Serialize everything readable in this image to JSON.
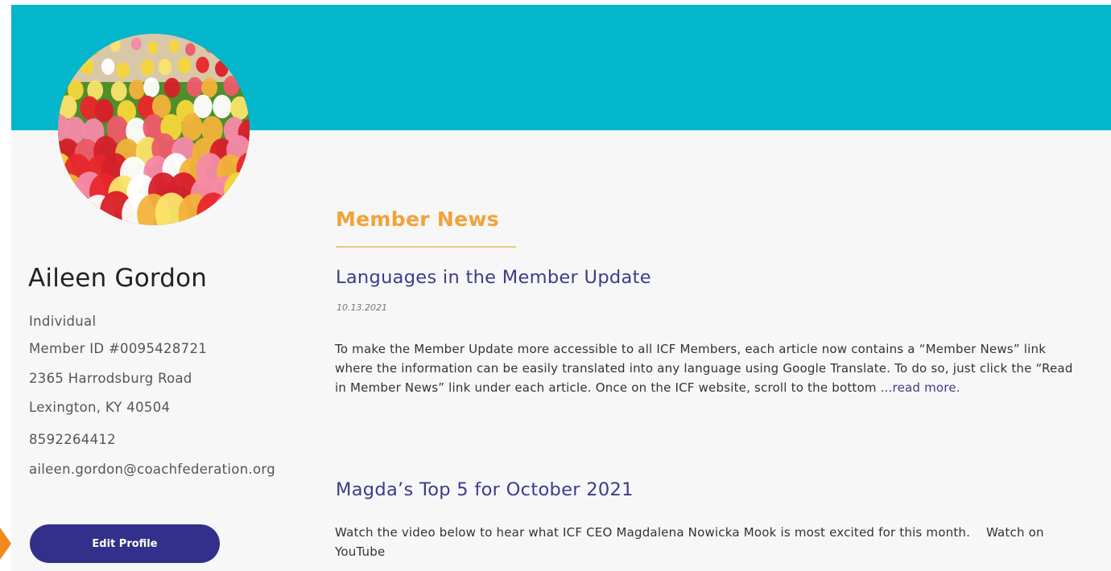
{
  "profile": {
    "name": "Aileen Gordon",
    "membership_type": "Individual",
    "member_id": "Member ID #0095428721",
    "address_line1": "2365 Harrodsburg Road",
    "address_line2": "Lexington, KY 40504",
    "phone": "8592264412",
    "email": "aileen.gordon@coachfederation.org",
    "edit_button_label": "Edit Profile"
  },
  "news": {
    "section_title": "Member News",
    "articles": [
      {
        "title": "Languages in the Member Update",
        "date": "10.13.2021",
        "body": "To make the Member Update more accessible to all ICF Members, each article now contains a “Member News” link where the information can be easily translated into any language using Google Translate. To do so, just click the “Read in Member News” link under each article. Once on the ICF website, scroll to the bottom ",
        "read_more": "...read more."
      },
      {
        "title": "Magda’s Top 5 for October 2021",
        "body": "Watch the video below to hear what ICF CEO Magdalena Nowicka Mook is most excited for this month.",
        "link_label": "Watch on YouTube"
      }
    ]
  },
  "colors": {
    "banner": "#04b6cc",
    "accent_orange": "#f2a23a",
    "link_purple": "#3d3b8a",
    "button": "#32308a",
    "pointer": "#f08a1d"
  },
  "icons": {
    "avatar": "tulip-field-photo",
    "pointer": "orange-arrow-pointer-icon"
  }
}
